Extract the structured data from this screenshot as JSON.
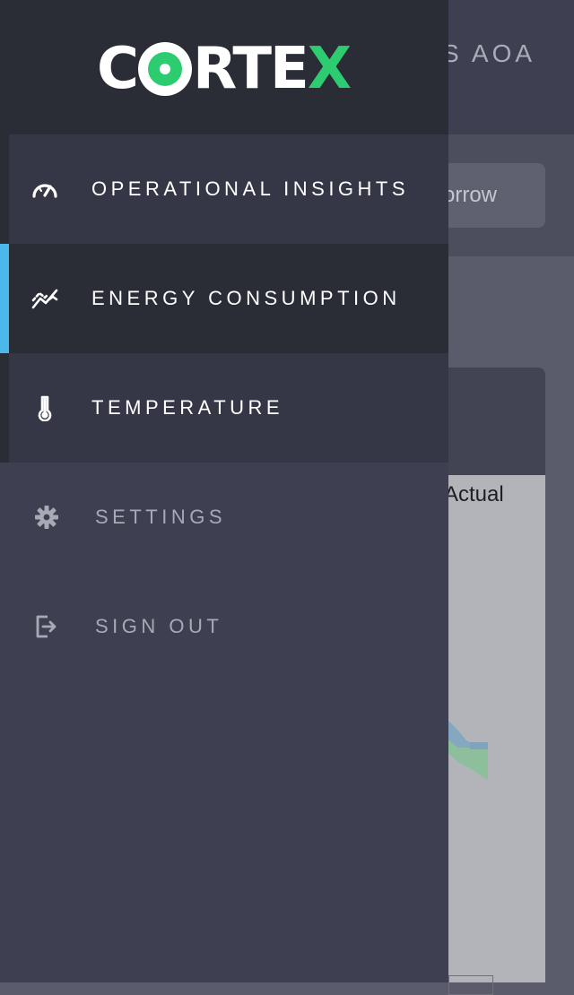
{
  "background": {
    "header_title": "S AOA",
    "toolbar_button": "orrow",
    "legend_label": "Actual"
  },
  "logo": {
    "part1": "C",
    "part2": "RTE",
    "part3": "X",
    "accent_color": "#2ecc71"
  },
  "nav": {
    "items": [
      {
        "label": "OPERATIONAL INSIGHTS",
        "icon": "speedometer-icon",
        "active": false
      },
      {
        "label": "ENERGY CONSUMPTION",
        "icon": "line-chart-icon",
        "active": true
      },
      {
        "label": "TEMPERATURE",
        "icon": "thermometer-icon",
        "active": false
      }
    ],
    "active_accent": "#4ab8ea"
  },
  "secondary": {
    "items": [
      {
        "label": "SETTINGS",
        "icon": "gear-icon"
      },
      {
        "label": "SIGN OUT",
        "icon": "sign-out-icon"
      }
    ]
  }
}
